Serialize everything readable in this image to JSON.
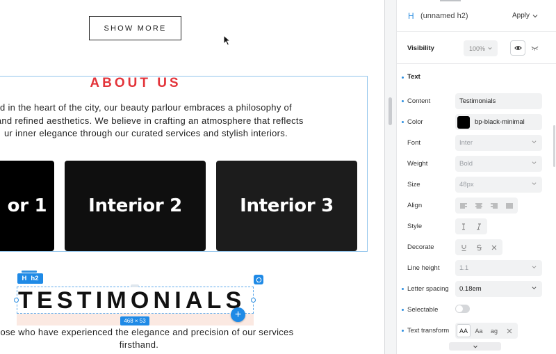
{
  "canvas": {
    "show_more": "SHOW MORE",
    "about_title": "ABOUT US",
    "about_lines": [
      "d in the heart of the city, our beauty parlour embraces a philosophy of",
      "n and refined aesthetics. We believe in crafting an atmosphere that reflects",
      "ur inner elegance through our curated services and stylish interiors."
    ],
    "cards": [
      "or 1",
      "Interior 2",
      "Interior 3"
    ],
    "element_badge": {
      "icon": "H",
      "tag": "h2"
    },
    "selected_heading": "TESTIMONIALS",
    "size_label": "468 × 53",
    "testimonial_lines": [
      "n those who have experienced the elegance and precision of our services",
      "firsthand."
    ],
    "plus_label": "+"
  },
  "panel": {
    "header": {
      "icon": "H",
      "name": "(unnamed h2)",
      "apply": "Apply"
    },
    "visibility": {
      "label": "Visibility",
      "opacity": "100%"
    },
    "section": "Text",
    "props": {
      "content": {
        "label": "Content",
        "value": "Testimonials"
      },
      "color": {
        "label": "Color",
        "value": "bp-black-minimal",
        "hex": "#000000"
      },
      "font": {
        "label": "Font",
        "value": "Inter"
      },
      "weight": {
        "label": "Weight",
        "value": "Bold"
      },
      "size": {
        "label": "Size",
        "value": "48px"
      },
      "align": {
        "label": "Align"
      },
      "style": {
        "label": "Style"
      },
      "decorate": {
        "label": "Decorate"
      },
      "line_height": {
        "label": "Line height",
        "value": "1.1"
      },
      "letter_spacing": {
        "label": "Letter spacing",
        "value": "0.18em"
      },
      "selectable": {
        "label": "Selectable"
      },
      "text_transform": {
        "label": "Text transform",
        "options": [
          "AA",
          "Aa",
          "ag"
        ]
      }
    }
  },
  "colors": {
    "accent": "#1f8ae6",
    "about_title": "#e3343a"
  }
}
